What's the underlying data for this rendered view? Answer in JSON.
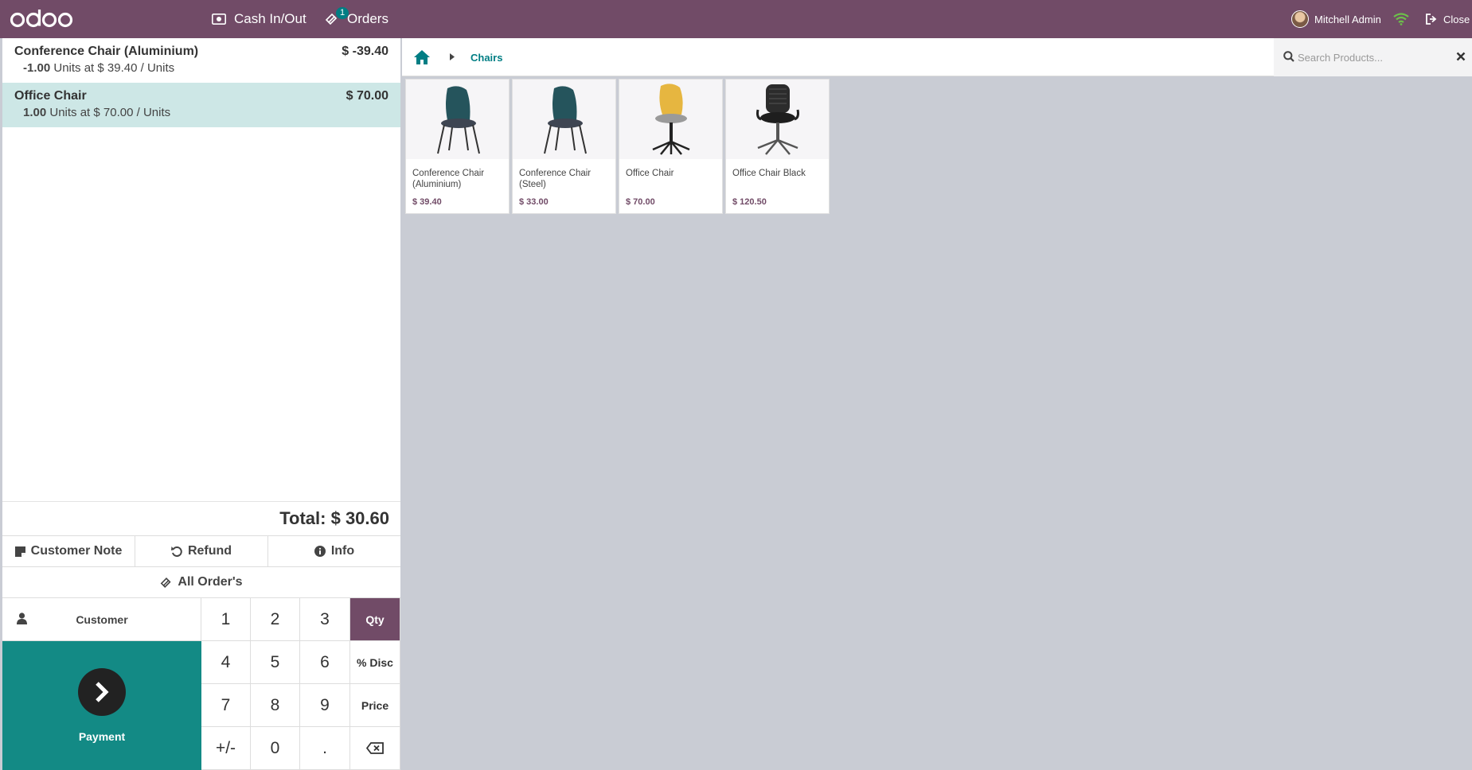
{
  "topbar": {
    "logo": "odoo",
    "cash_label": "Cash In/Out",
    "orders_label": "Orders",
    "orders_badge": "1",
    "user_name": "Mitchell Admin",
    "close_label": "Close"
  },
  "order": {
    "lines": [
      {
        "name": "Conference Chair (Aluminium)",
        "price": "$ -39.40",
        "qty": "-1.00",
        "detail": "Units at $ 39.40 / Units"
      },
      {
        "name": "Office Chair",
        "price": "$ 70.00",
        "qty": "1.00",
        "detail": "Units at $ 70.00 / Units"
      }
    ],
    "total": "Total: $ 30.60"
  },
  "controls": {
    "customer_note": "Customer Note",
    "refund": "Refund",
    "info": "Info",
    "all_orders": "All Order's",
    "customer": "Customer",
    "payment": "Payment"
  },
  "numpad": {
    "keys": [
      "1",
      "2",
      "3",
      "Qty",
      "4",
      "5",
      "6",
      "% Disc",
      "7",
      "8",
      "9",
      "Price",
      "+/-",
      "0",
      "."
    ]
  },
  "breadcrumb": {
    "category": "Chairs"
  },
  "search": {
    "placeholder": "Search Products..."
  },
  "products": [
    {
      "name": "Conference Chair (Aluminium)",
      "price": "$ 39.40",
      "image": "teal-chair"
    },
    {
      "name": "Conference Chair (Steel)",
      "price": "$ 33.00",
      "image": "teal-chair"
    },
    {
      "name": "Office Chair",
      "price": "$ 70.00",
      "image": "yellow-swivel-chair"
    },
    {
      "name": "Office Chair Black",
      "price": "$ 120.50",
      "image": "black-office-chair"
    }
  ],
  "colors": {
    "brand": "#714b67",
    "accent": "#017e84",
    "payment": "#138a85",
    "selected_line": "#cde7e6"
  }
}
